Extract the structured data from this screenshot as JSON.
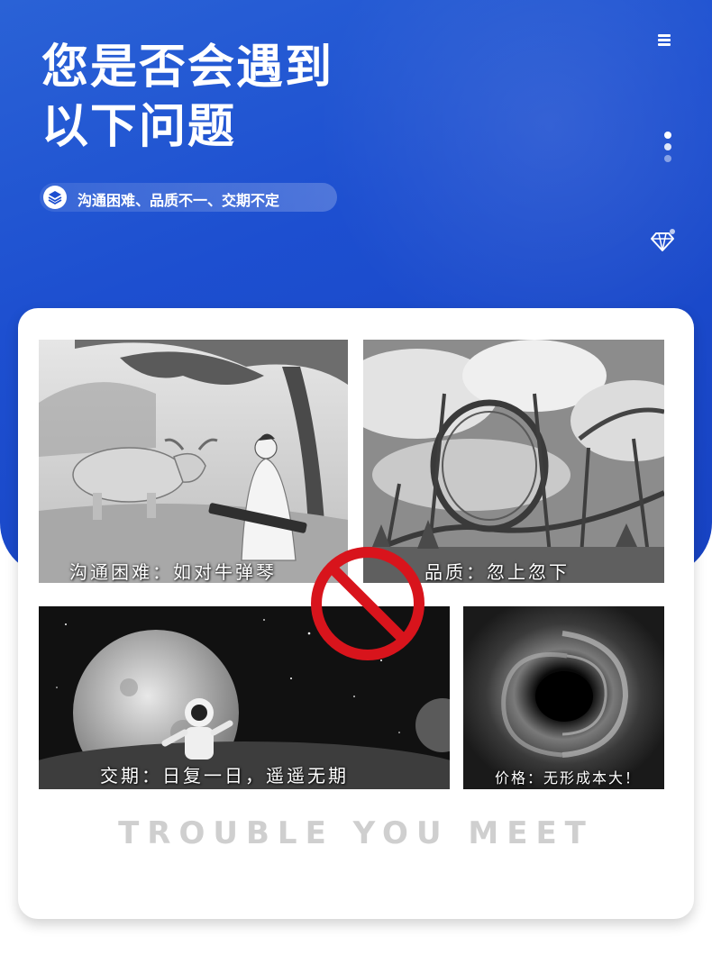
{
  "header": {
    "title_line1": "您是否会遇到",
    "title_line2": "以下问题",
    "tagline": "沟通困难、品质不一、交期不定",
    "tagline_icon": "layers-icon",
    "menu_icon": "hamburger-menu-icon",
    "dots_icon": "vertical-dots-icon",
    "diamond_icon": "diamond-icon"
  },
  "colors": {
    "hero_blue": "#1d4fd0",
    "no_sign_red": "#d8141c",
    "english_subtitle": "#cfcfcf"
  },
  "panels": [
    {
      "caption": "沟通困难：如对牛弹琴",
      "scene": "ox-and-zither-player"
    },
    {
      "caption": "品质：忽上忽下",
      "scene": "roller-coaster"
    },
    {
      "caption": "交期：日复一日，遥遥无期",
      "scene": "astronaut-and-moon"
    },
    {
      "caption": "价格：无形成本大！",
      "scene": "black-hole"
    }
  ],
  "prohibition_icon": "no-sign-icon",
  "subtitle_en": "TROUBLE YOU MEET"
}
